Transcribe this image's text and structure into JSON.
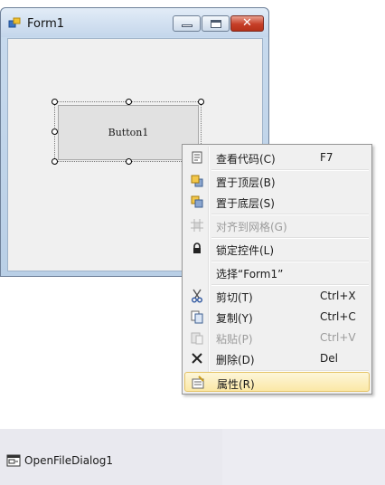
{
  "form": {
    "title": "Form1",
    "icon": "form-icon",
    "window_controls": [
      "minimize",
      "maximize",
      "close"
    ],
    "close_glyph": "✕"
  },
  "designer": {
    "button_text": "Button1"
  },
  "context_menu": {
    "items": [
      {
        "label": "查看代码(C)",
        "shortcut": "F7",
        "icon": "view-code-icon",
        "enabled": true
      },
      {
        "label": "置于顶层(B)",
        "shortcut": "",
        "icon": "bring-to-front-icon",
        "enabled": true
      },
      {
        "label": "置于底层(S)",
        "shortcut": "",
        "icon": "send-to-back-icon",
        "enabled": true
      },
      {
        "label": "对齐到网格(G)",
        "shortcut": "",
        "icon": "align-to-grid-icon",
        "enabled": false
      },
      {
        "label": "锁定控件(L)",
        "shortcut": "",
        "icon": "lock-icon",
        "enabled": true
      },
      {
        "label": "选择“Form1”",
        "shortcut": "",
        "icon": "",
        "enabled": true
      },
      {
        "label": "剪切(T)",
        "shortcut": "Ctrl+X",
        "icon": "cut-icon",
        "enabled": true
      },
      {
        "label": "复制(Y)",
        "shortcut": "Ctrl+C",
        "icon": "copy-icon",
        "enabled": true
      },
      {
        "label": "粘贴(P)",
        "shortcut": "Ctrl+V",
        "icon": "paste-icon",
        "enabled": false
      },
      {
        "label": "删除(D)",
        "shortcut": "Del",
        "icon": "delete-icon",
        "enabled": true
      },
      {
        "label": "属性(R)",
        "shortcut": "",
        "icon": "properties-icon",
        "enabled": true,
        "highlighted": true
      }
    ]
  },
  "component_tray": {
    "items": [
      {
        "label": "OpenFileDialog1",
        "icon": "open-file-dialog-icon"
      }
    ]
  },
  "colors": {
    "highlight": "#fbe8a6",
    "close_button": "#c63e27",
    "title_bar": "#c4d6eb"
  }
}
